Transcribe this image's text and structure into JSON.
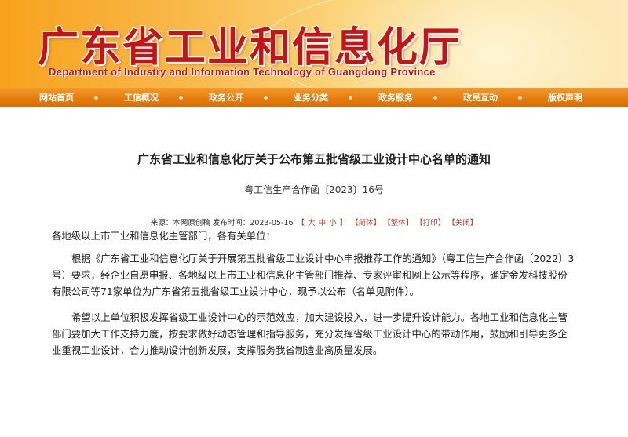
{
  "banner": {
    "title": "广东省工业和信息化厅",
    "subtitle": "Department of Industry and Information Technology of Guangdong Province"
  },
  "nav": {
    "items": [
      {
        "label": "网站首页"
      },
      {
        "label": "工信概况"
      },
      {
        "label": "政务公开"
      },
      {
        "label": "业务分类"
      },
      {
        "label": "政务服务"
      },
      {
        "label": "政民互动"
      },
      {
        "label": "版权声明"
      }
    ]
  },
  "article": {
    "title": "广东省工业和信息化厅关于公布第五批省级工业设计中心名单的通知",
    "doc_number": "粤工信生产合作函〔2023〕16号",
    "meta": {
      "source_label": "来源：",
      "source_value": "本网原创稿",
      "date_label": "发布时间：",
      "date_value": "2023-05-16",
      "size_open": "【",
      "size_large": "大",
      "size_medium": "中",
      "size_small": "小",
      "size_close": "】",
      "simplified": "【简体】",
      "traditional": "【繁体】",
      "print": "【打印】",
      "close": "【关闭】"
    },
    "salutation": "各地级以上市工业和信息化主管部门，各有关单位：",
    "paragraphs": [
      "根据《广东省工业和信息化厅关于开展第五批省级工业设计中心申报推荐工作的通知》（粤工信生产合作函〔2022〕3号）要求，经企业自愿申报、各地级以上市工业和信息化主管部门推荐、专家评审和网上公示等程序，确定金发科技股份有限公司等71家单位为广东省第五批省级工业设计中心，现予以公布（名单见附件）。",
      "希望以上单位积极发挥省级工业设计中心的示范效应，加大建设投入，进一步提升设计能力。各地工业和信息化主管部门要加大工作支持力度，按要求做好动态管理和指导服务，充分发挥省级工业设计中心的带动作用，鼓励和引导更多企业重视工业设计，合力推动设计创新发展，支撑服务我省制造业高质量发展。"
    ]
  },
  "colors": {
    "banner_title": "#c61414",
    "nav_bg": "#e77d10",
    "link": "#c0392b"
  }
}
